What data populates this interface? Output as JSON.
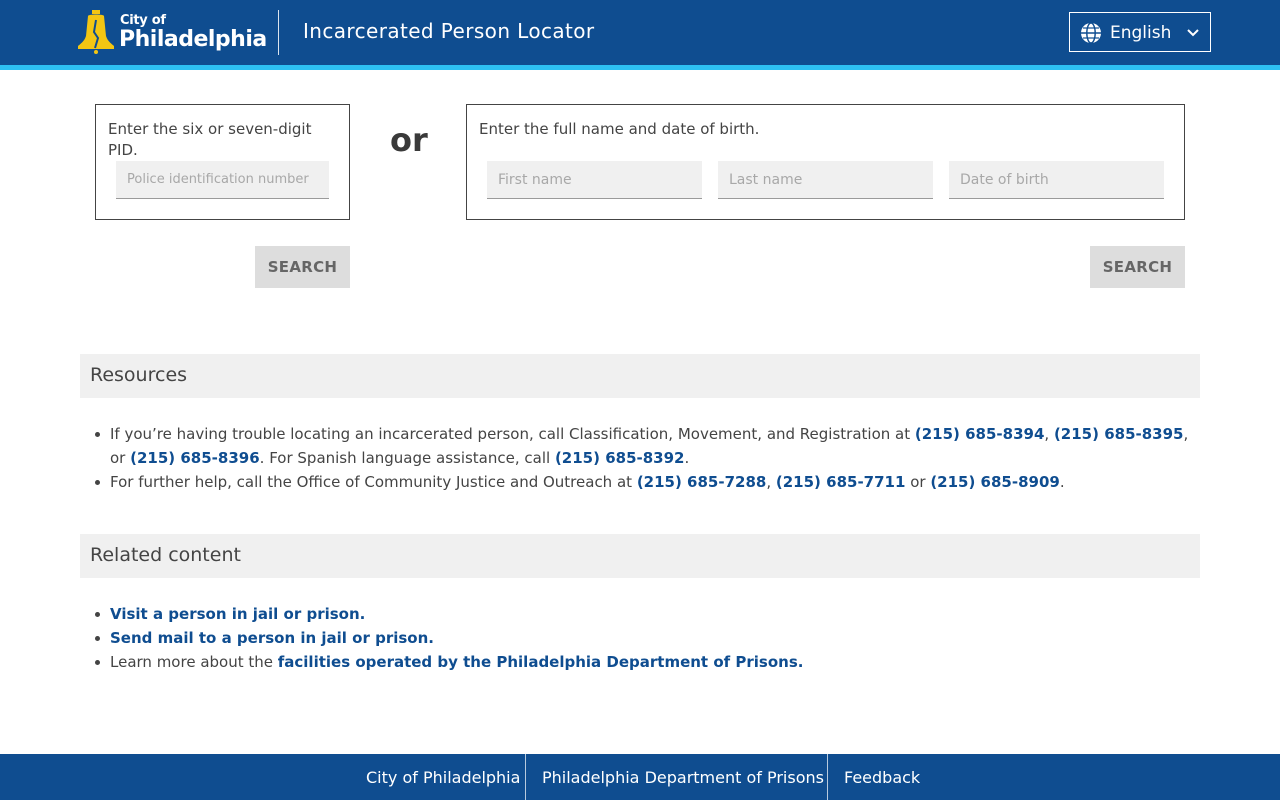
{
  "header": {
    "logo_small": "City of",
    "logo_big": "Philadelphia",
    "app_title": "Incarcerated Person Locator",
    "language": "English",
    "colors": {
      "header_bg": "#0f4d90",
      "stripe": "#2dc0f2",
      "bell": "#f3c613",
      "link": "#0f4d90"
    }
  },
  "pid_search": {
    "prompt": "Enter the six or seven-digit PID.",
    "placeholder": "Police identification number",
    "button": "SEARCH"
  },
  "or_label": "or",
  "name_search": {
    "prompt": "Enter the full name and date of birth.",
    "first_placeholder": "First name",
    "last_placeholder": "Last name",
    "dob_placeholder": "Date of birth",
    "button": "SEARCH"
  },
  "resources": {
    "heading": "Resources",
    "item1": {
      "text_a": "If you’re having trouble locating an incarcerated person, call Classification, Movement, and Registration at ",
      "phone1": "(215) 685-8394",
      "sep1": ", ",
      "phone2": "(215) 685-8395",
      "sep2": ", or ",
      "phone3": "(215) 685-8396",
      "text_b": ". For Spanish language assistance, call ",
      "phone4": "(215) 685-8392",
      "text_c": "."
    },
    "item2": {
      "text_a": "For further help, call the Office of Community Justice and Outreach at ",
      "phone1": "(215) 685-7288",
      "sep1": ", ",
      "phone2": "(215) 685-7711",
      "sep2": " or ",
      "phone3": "(215) 685-8909",
      "text_b": "."
    }
  },
  "related": {
    "heading": "Related content",
    "link1": "Visit a person in jail or prison.",
    "link2": "Send mail to a person in jail or prison.",
    "item3_text": "Learn more about the ",
    "item3_link": "facilities operated by the Philadelphia Department of Prisons."
  },
  "footer": {
    "link1": "City of Philadelphia",
    "link2": "Philadelphia Department of Prisons",
    "link3": "Feedback"
  }
}
